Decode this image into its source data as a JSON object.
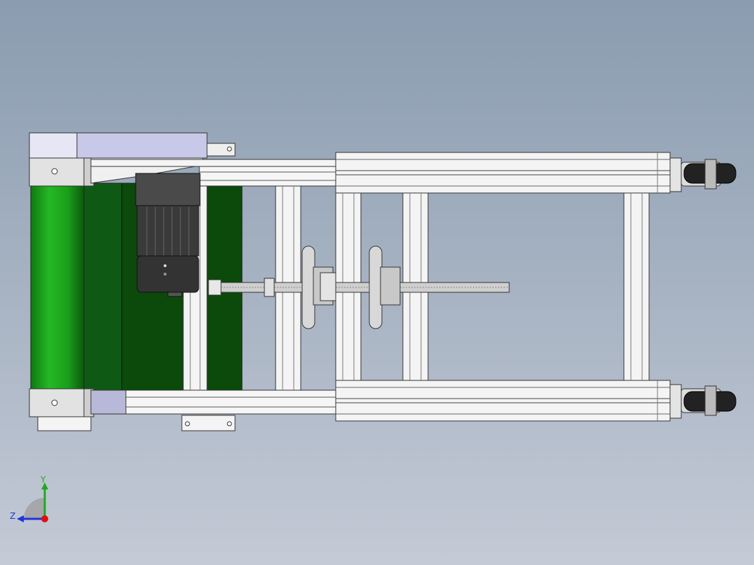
{
  "viewport": {
    "background_top": "#8a9cb0",
    "background_bottom": "#c4cad6"
  },
  "model": {
    "belt_color": "#1f9e1f",
    "belt_dark_color": "#0b4a0b",
    "motor_color": "#3a3a3a",
    "frame_color": "#f2f2f2",
    "cover_color": "#c8c8e8"
  },
  "triad": {
    "y_label": "Y",
    "z_label": "Z",
    "y_color": "#1faa1f",
    "z_color": "#2233dd",
    "x_color": "#e01010"
  }
}
